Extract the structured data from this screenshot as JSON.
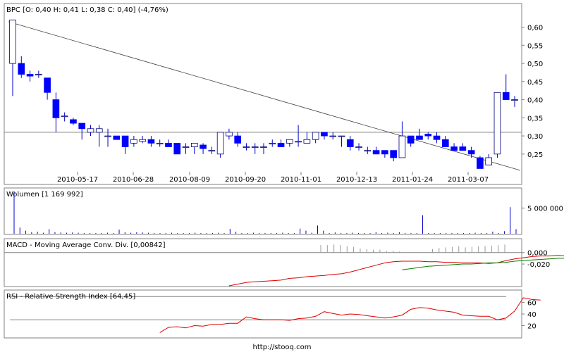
{
  "footer": "http://stooq.com",
  "chart_data": [
    {
      "type": "candlestick",
      "legend": "BPC [O: 0,40  H: 0,41  L: 0,38  C: 0,40] (-4,76%)",
      "ylim": [
        0.205,
        0.64
      ],
      "y_ticks": [
        0.25,
        0.3,
        0.35,
        0.4,
        0.45,
        0.5,
        0.55,
        0.6
      ],
      "y_tick_labels": [
        "0,25",
        "0,30",
        "0,35",
        "0,40",
        "0,45",
        "0,50",
        "0,55",
        "0,60"
      ],
      "x_ticks": [
        "2010-05-17",
        "2010-06-28",
        "2010-08-09",
        "2010-09-20",
        "2010-11-01",
        "2010-12-13",
        "2011-01-24",
        "2011-03-07"
      ],
      "reference_line": 0.31,
      "trend_line": {
        "start": 0.615,
        "end": 0.205
      },
      "candles": [
        {
          "o": 0.5,
          "h": 0.62,
          "l": 0.41,
          "c": 0.62
        },
        {
          "o": 0.5,
          "h": 0.52,
          "l": 0.46,
          "c": 0.47
        },
        {
          "o": 0.47,
          "h": 0.48,
          "l": 0.45,
          "c": 0.465
        },
        {
          "o": 0.47,
          "h": 0.48,
          "l": 0.46,
          "c": 0.47
        },
        {
          "o": 0.46,
          "h": 0.46,
          "l": 0.4,
          "c": 0.42
        },
        {
          "o": 0.4,
          "h": 0.42,
          "l": 0.31,
          "c": 0.35
        },
        {
          "o": 0.355,
          "h": 0.365,
          "l": 0.34,
          "c": 0.355
        },
        {
          "o": 0.345,
          "h": 0.35,
          "l": 0.33,
          "c": 0.335
        },
        {
          "o": 0.335,
          "h": 0.335,
          "l": 0.29,
          "c": 0.32
        },
        {
          "o": 0.31,
          "h": 0.33,
          "l": 0.3,
          "c": 0.32
        },
        {
          "o": 0.31,
          "h": 0.33,
          "l": 0.27,
          "c": 0.32
        },
        {
          "o": 0.3,
          "h": 0.32,
          "l": 0.27,
          "c": 0.3
        },
        {
          "o": 0.3,
          "h": 0.3,
          "l": 0.29,
          "c": 0.29
        },
        {
          "o": 0.3,
          "h": 0.3,
          "l": 0.25,
          "c": 0.27
        },
        {
          "o": 0.28,
          "h": 0.3,
          "l": 0.27,
          "c": 0.29
        },
        {
          "o": 0.285,
          "h": 0.3,
          "l": 0.28,
          "c": 0.29
        },
        {
          "o": 0.29,
          "h": 0.3,
          "l": 0.27,
          "c": 0.28
        },
        {
          "o": 0.28,
          "h": 0.29,
          "l": 0.27,
          "c": 0.28
        },
        {
          "o": 0.28,
          "h": 0.29,
          "l": 0.27,
          "c": 0.27
        },
        {
          "o": 0.28,
          "h": 0.28,
          "l": 0.25,
          "c": 0.25
        },
        {
          "o": 0.27,
          "h": 0.28,
          "l": 0.25,
          "c": 0.27
        },
        {
          "o": 0.27,
          "h": 0.28,
          "l": 0.25,
          "c": 0.28
        },
        {
          "o": 0.275,
          "h": 0.28,
          "l": 0.25,
          "c": 0.265
        },
        {
          "o": 0.26,
          "h": 0.27,
          "l": 0.25,
          "c": 0.26
        },
        {
          "o": 0.25,
          "h": 0.31,
          "l": 0.24,
          "c": 0.31
        },
        {
          "o": 0.3,
          "h": 0.32,
          "l": 0.29,
          "c": 0.31
        },
        {
          "o": 0.3,
          "h": 0.31,
          "l": 0.27,
          "c": 0.28
        },
        {
          "o": 0.27,
          "h": 0.28,
          "l": 0.26,
          "c": 0.27
        },
        {
          "o": 0.27,
          "h": 0.28,
          "l": 0.25,
          "c": 0.27
        },
        {
          "o": 0.27,
          "h": 0.28,
          "l": 0.25,
          "c": 0.27
        },
        {
          "o": 0.28,
          "h": 0.29,
          "l": 0.27,
          "c": 0.28
        },
        {
          "o": 0.28,
          "h": 0.29,
          "l": 0.27,
          "c": 0.27
        },
        {
          "o": 0.28,
          "h": 0.29,
          "l": 0.27,
          "c": 0.29
        },
        {
          "o": 0.285,
          "h": 0.33,
          "l": 0.27,
          "c": 0.285
        },
        {
          "o": 0.28,
          "h": 0.31,
          "l": 0.28,
          "c": 0.29
        },
        {
          "o": 0.29,
          "h": 0.31,
          "l": 0.28,
          "c": 0.31
        },
        {
          "o": 0.31,
          "h": 0.31,
          "l": 0.29,
          "c": 0.3
        },
        {
          "o": 0.3,
          "h": 0.31,
          "l": 0.29,
          "c": 0.3
        },
        {
          "o": 0.3,
          "h": 0.3,
          "l": 0.27,
          "c": 0.3
        },
        {
          "o": 0.29,
          "h": 0.3,
          "l": 0.26,
          "c": 0.27
        },
        {
          "o": 0.27,
          "h": 0.28,
          "l": 0.26,
          "c": 0.27
        },
        {
          "o": 0.26,
          "h": 0.27,
          "l": 0.25,
          "c": 0.26
        },
        {
          "o": 0.26,
          "h": 0.27,
          "l": 0.25,
          "c": 0.25
        },
        {
          "o": 0.26,
          "h": 0.26,
          "l": 0.24,
          "c": 0.25
        },
        {
          "o": 0.26,
          "h": 0.26,
          "l": 0.23,
          "c": 0.24
        },
        {
          "o": 0.24,
          "h": 0.34,
          "l": 0.24,
          "c": 0.3
        },
        {
          "o": 0.3,
          "h": 0.3,
          "l": 0.27,
          "c": 0.28
        },
        {
          "o": 0.3,
          "h": 0.32,
          "l": 0.29,
          "c": 0.29
        },
        {
          "o": 0.305,
          "h": 0.31,
          "l": 0.29,
          "c": 0.3
        },
        {
          "o": 0.3,
          "h": 0.31,
          "l": 0.28,
          "c": 0.29
        },
        {
          "o": 0.29,
          "h": 0.3,
          "l": 0.27,
          "c": 0.27
        },
        {
          "o": 0.27,
          "h": 0.28,
          "l": 0.26,
          "c": 0.26
        },
        {
          "o": 0.27,
          "h": 0.28,
          "l": 0.26,
          "c": 0.26
        },
        {
          "o": 0.26,
          "h": 0.27,
          "l": 0.24,
          "c": 0.25
        },
        {
          "o": 0.24,
          "h": 0.245,
          "l": 0.21,
          "c": 0.21
        },
        {
          "o": 0.22,
          "h": 0.25,
          "l": 0.22,
          "c": 0.24
        },
        {
          "o": 0.25,
          "h": 0.42,
          "l": 0.24,
          "c": 0.42
        },
        {
          "o": 0.42,
          "h": 0.47,
          "l": 0.4,
          "c": 0.4
        },
        {
          "o": 0.4,
          "h": 0.41,
          "l": 0.38,
          "c": 0.4
        }
      ]
    },
    {
      "type": "bar",
      "legend": "Wolumen [1 169 992]",
      "ylim": [
        0,
        8800000
      ],
      "y_ticks": [
        5000000
      ],
      "y_tick_labels": [
        "5 000 000"
      ],
      "values": [
        8300000,
        1200000,
        600000,
        300000,
        400000,
        200000,
        900000,
        300000,
        250000,
        200000,
        250000,
        200000,
        150000,
        150000,
        150000,
        150000,
        200000,
        150000,
        800000,
        300000,
        200000,
        300000,
        250000,
        200000,
        150000,
        150000,
        150000,
        200000,
        150000,
        150000,
        150000,
        200000,
        150000,
        150000,
        150000,
        200000,
        150000,
        950000,
        400000,
        150000,
        150000,
        200000,
        150000,
        150000,
        150000,
        150000,
        200000,
        150000,
        150000,
        1000000,
        600000,
        200000,
        1600000,
        600000,
        150000,
        250000,
        150000,
        150000,
        200000,
        150000,
        150000,
        150000,
        300000,
        150000,
        200000,
        150000,
        300000,
        150000,
        150000,
        150000,
        3600000,
        150000,
        150000,
        150000,
        150000,
        150000,
        150000,
        150000,
        150000,
        200000,
        150000,
        150000,
        400000,
        150000,
        500000,
        5200000,
        900000
      ]
    },
    {
      "type": "line",
      "legend": "MACD - Moving Average Conv. Div. [0,00842]",
      "ylim": [
        -0.058,
        0.023
      ],
      "y_ticks": [
        0.0,
        -0.02
      ],
      "y_tick_labels": [
        "0,000",
        "-0,020"
      ],
      "series": [
        {
          "color": "#dd0000",
          "start_index": 25,
          "values": [
            -0.058,
            -0.055,
            -0.052,
            -0.051,
            -0.05,
            -0.049,
            -0.048,
            -0.045,
            -0.044,
            -0.042,
            -0.041,
            -0.04,
            -0.038,
            -0.037,
            -0.034,
            -0.03,
            -0.026,
            -0.022,
            -0.018,
            -0.016,
            -0.015,
            -0.015,
            -0.015,
            -0.016,
            -0.016,
            -0.017,
            -0.017,
            -0.018,
            -0.018,
            -0.018,
            -0.019,
            -0.018,
            -0.014,
            -0.011,
            -0.009,
            -0.007,
            -0.006,
            -0.006,
            -0.005,
            -0.006,
            -0.008,
            -0.009,
            -0.01,
            -0.011,
            -0.011,
            -0.003,
            0.001,
            0.008
          ]
        },
        {
          "color": "#008000",
          "start_index": 45,
          "values": [
            -0.03,
            -0.028,
            -0.026,
            -0.024,
            -0.023,
            -0.022,
            -0.021,
            -0.02,
            -0.02,
            -0.019,
            -0.018,
            -0.018,
            -0.017,
            -0.015,
            -0.014,
            -0.013,
            -0.012,
            -0.011,
            -0.01,
            -0.01,
            -0.009,
            -0.009,
            -0.01,
            -0.008,
            -0.006
          ]
        }
      ],
      "histogram": [
        0.013,
        0.013,
        0.014,
        0.013,
        0.011,
        0.01,
        0.007,
        0.006,
        0.005,
        0.005,
        0.003,
        0.003,
        0.002,
        0.001,
        0.001,
        0.001,
        0.001,
        0.006,
        0.008,
        0.009,
        0.01,
        0.011,
        0.009,
        0.01,
        0.011,
        0.011,
        0.012,
        0.013,
        0.014
      ]
    },
    {
      "type": "line",
      "legend": "RSI - Relative Strength Index [64,45]",
      "ylim": [
        0,
        80
      ],
      "y_ticks": [
        60,
        40,
        20
      ],
      "y_tick_labels": [
        "60",
        "40",
        "20"
      ],
      "guides": [
        70,
        30
      ],
      "series": [
        {
          "color": "#dd0000",
          "start_index": 17,
          "values": [
            8,
            17,
            18,
            16,
            20,
            19,
            22,
            22,
            24,
            24,
            35,
            32,
            30,
            30,
            30,
            29,
            32,
            33,
            36,
            44,
            41,
            38,
            40,
            39,
            37,
            35,
            33,
            35,
            38,
            48,
            51,
            50,
            47,
            45,
            43,
            38,
            37,
            36,
            36,
            30,
            33,
            45,
            68,
            65,
            64
          ]
        }
      ]
    }
  ]
}
